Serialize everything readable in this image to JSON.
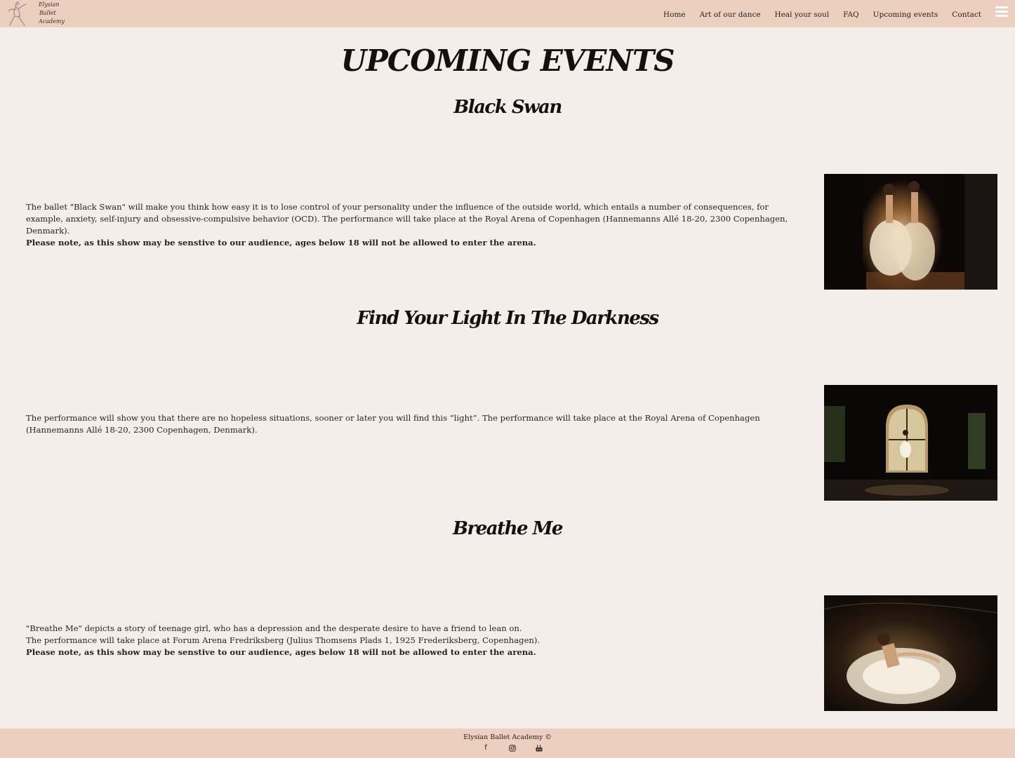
{
  "header": {
    "logo": {
      "lines": [
        "Elysian",
        "Ballet",
        "Academy"
      ]
    },
    "nav": [
      "Home",
      "Art of our dance",
      "Heal your soul",
      "FAQ",
      "Upcoming events",
      "Contact"
    ]
  },
  "page": {
    "title": "UPCOMING EVENTS"
  },
  "events": [
    {
      "title": "Black Swan",
      "description": "The ballet \"Black Swan\" will make you think how easy it is to lose control of your personality under the influence of the outside world, which entails a number of consequences, for example, anxiety, self-injury and obsessive-compulsive behavior (OCD). The performance will take place at the Royal Arena of Copenhagen (Hannemanns Allé 18-20, 2300 Copenhagen, Denmark).",
      "note": "Please note, as this show may be senstive to our audience, ages below 18 will not be allowed to enter the arena."
    },
    {
      "title": "Find Your Light In The Darkness",
      "description": "The performance will show you that there are no hopeless situations, sooner or later you will find this “light”. The performance will take place at the Royal Arena of Copenhagen (Hannemanns Allé 18-20, 2300 Copenhagen, Denmark)."
    },
    {
      "title": "Breathe Me",
      "description_line1": "\"Breathe Me\" depicts a story of teenage girl, who has a depression and the desperate desire to have a friend to lean on.",
      "description_line2": "The performance will take place at Forum Arena Fredriksberg (Julius Thomsens Plads 1, 1925 Frederiksberg, Copenhagen).",
      "note": "Please note, as this show may be senstive to our audience, ages below 18 will not be allowed to enter the arena."
    }
  ],
  "footer": {
    "text": "Elysian Ballet Academy ©",
    "icons": [
      "facebook-icon",
      "instagram-icon",
      "youtube-icon"
    ]
  }
}
